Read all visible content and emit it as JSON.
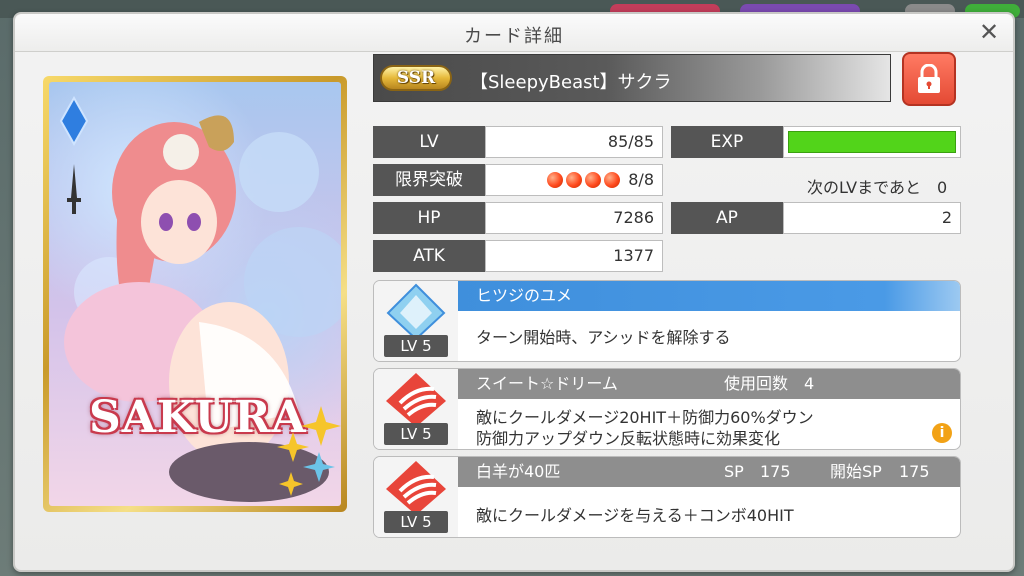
{
  "dialog": {
    "title": "カード詳細",
    "close_glyph": "✕"
  },
  "card": {
    "rarity": "SSR",
    "title": "【SleepyBeast】サクラ",
    "art_name": "SAKURA",
    "locked": true
  },
  "stats": {
    "lv_label": "LV",
    "lv_value": "85/85",
    "limit_label": "限界突破",
    "limit_value": "8/8",
    "limit_orbs": 4,
    "hp_label": "HP",
    "hp_value": "7286",
    "atk_label": "ATK",
    "atk_value": "1377",
    "exp_label": "EXP",
    "exp_progress": 1.0,
    "next_lv_text": "次のLVまであと　0",
    "ap_label": "AP",
    "ap_value": "2"
  },
  "skills": [
    {
      "name": "ヒツジのユメ",
      "level": "LV 5",
      "desc1": "ターン開始時、アシッドを解除する",
      "color": "#3f8fdc",
      "icon": "diamond-skill-icon"
    },
    {
      "name": "スイート☆ドリーム",
      "level": "LV 5",
      "uses_label": "使用回数",
      "uses_value": "4",
      "desc1": "敵にクールダメージ20HIT＋防御力60%ダウン",
      "desc2": "防御力アップダウン反転状態時に効果変化",
      "color": "#8e8e8e",
      "icon": "claw-skill-icon"
    },
    {
      "name": "白羊が40匹",
      "level": "LV 5",
      "sp_label": "SP",
      "sp_value": "175",
      "start_sp_label": "開始SP",
      "start_sp_value": "175",
      "desc1": "敵にクールダメージを与える＋コンボ40HIT",
      "color": "#8e8e8e",
      "icon": "claw-skill-icon"
    }
  ],
  "colors": {
    "accent_blue": "#3f8fdc",
    "lock_red": "#e44a34",
    "exp_green": "#52d41a",
    "info_orange": "#f2a216"
  }
}
